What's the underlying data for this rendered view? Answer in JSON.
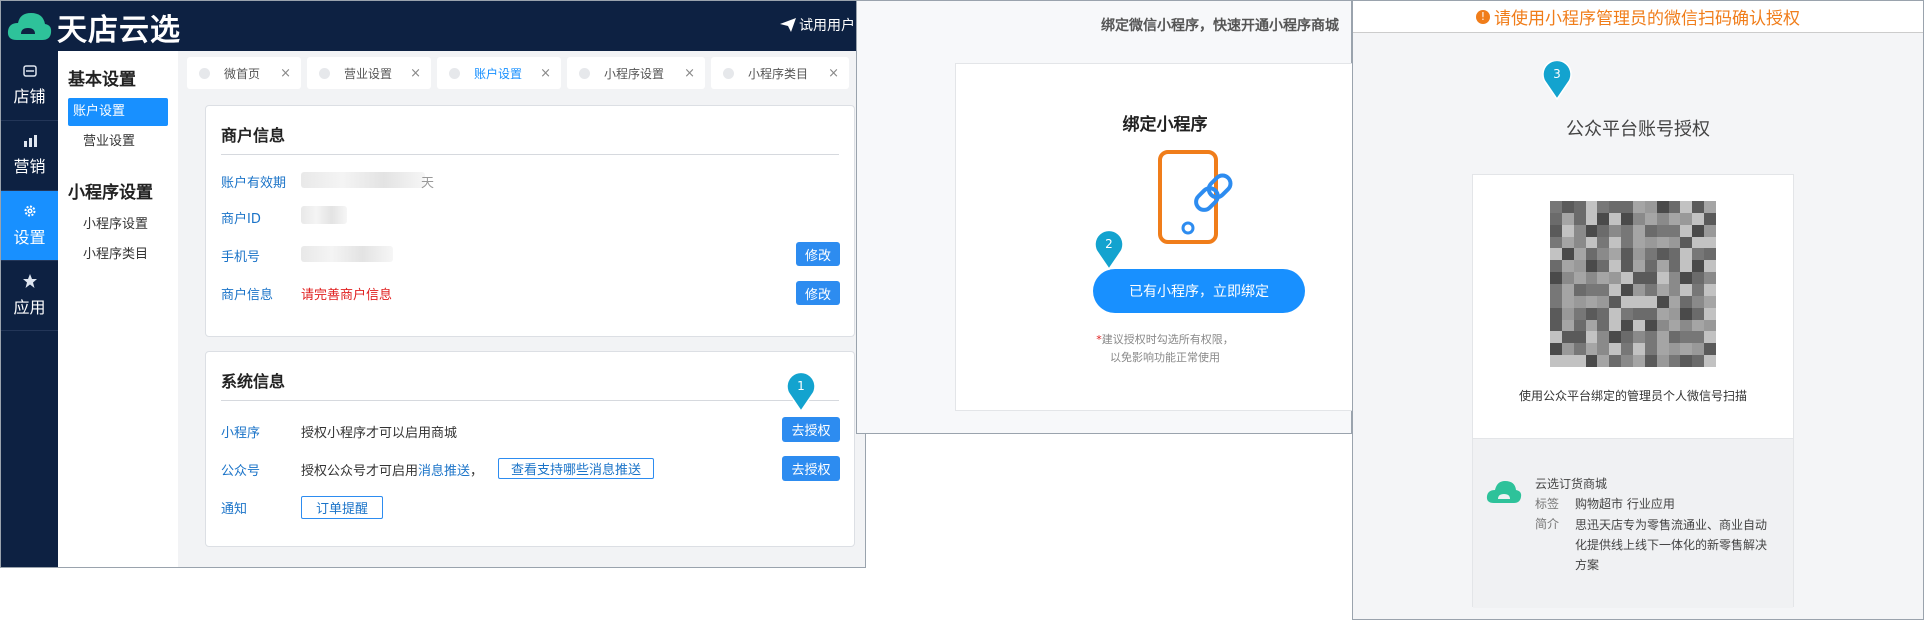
{
  "app": {
    "logo_text": "天店云选",
    "user": "试用用户",
    "nav": [
      {
        "label": "店铺",
        "icon": "store-icon"
      },
      {
        "label": "营销",
        "icon": "bar-chart-icon"
      },
      {
        "label": "设置",
        "icon": "gear-icon",
        "active": true
      },
      {
        "label": "应用",
        "icon": "star-icon"
      }
    ],
    "submenu": {
      "basic_heading": "基本设置",
      "basic_items": [
        "账户设置",
        "营业设置"
      ],
      "mini_heading": "小程序设置",
      "mini_items": [
        "小程序设置",
        "小程序类目"
      ]
    },
    "tabs": [
      {
        "label": "微首页"
      },
      {
        "label": "营业设置"
      },
      {
        "label": "账户设置",
        "active": true
      },
      {
        "label": "小程序设置"
      },
      {
        "label": "小程序类目"
      }
    ],
    "tab_close": "×",
    "merchant": {
      "title": "商户信息",
      "validity_label": "账户有效期",
      "validity_suffix": "天",
      "id_label": "商户ID",
      "phone_label": "手机号",
      "info_label": "商户信息",
      "info_value": "请完善商户信息",
      "modify": "修改"
    },
    "system": {
      "title": "系统信息",
      "mini_label": "小程序",
      "mini_desc": "授权小程序才可以启用商城",
      "oa_label": "公众号",
      "oa_desc_prefix": "授权公众号才可启用",
      "oa_link": "消息推送",
      "oa_comma": "，",
      "oa_outline_link": "查看支持哪些消息推送",
      "notice_label": "通知",
      "notice_button": "订单提醒",
      "authorize": "去授权"
    }
  },
  "steps": [
    "1",
    "2",
    "3"
  ],
  "bind_panel": {
    "header": "绑定微信小程序，快速开通小程序商城",
    "title": "绑定小程序",
    "button": "已有小程序，立即绑定",
    "note_star": "*",
    "note_line1": "建议授权时勾选所有权限，",
    "note_line2": "以免影响功能正常使用",
    "accent": "#1890ff",
    "icon_color": "#f07d1a"
  },
  "auth_panel": {
    "warning": "请使用小程序管理员的微信扫码确认授权",
    "warning_icon": "!",
    "title": "公众平台账号授权",
    "qr_caption": "使用公众平台绑定的管理员个人微信号扫描",
    "app_name": "云选订货商城",
    "tags_label": "标签",
    "tags_value": "购物超市 行业应用",
    "intro_label": "简介",
    "intro_lines": [
      "思迅天店专为零售流通业、商业自动",
      "化提供线上线下一体化的新零售解决",
      "方案"
    ],
    "warn_color": "#f07d1a",
    "logo_color": "#2ec29a"
  }
}
